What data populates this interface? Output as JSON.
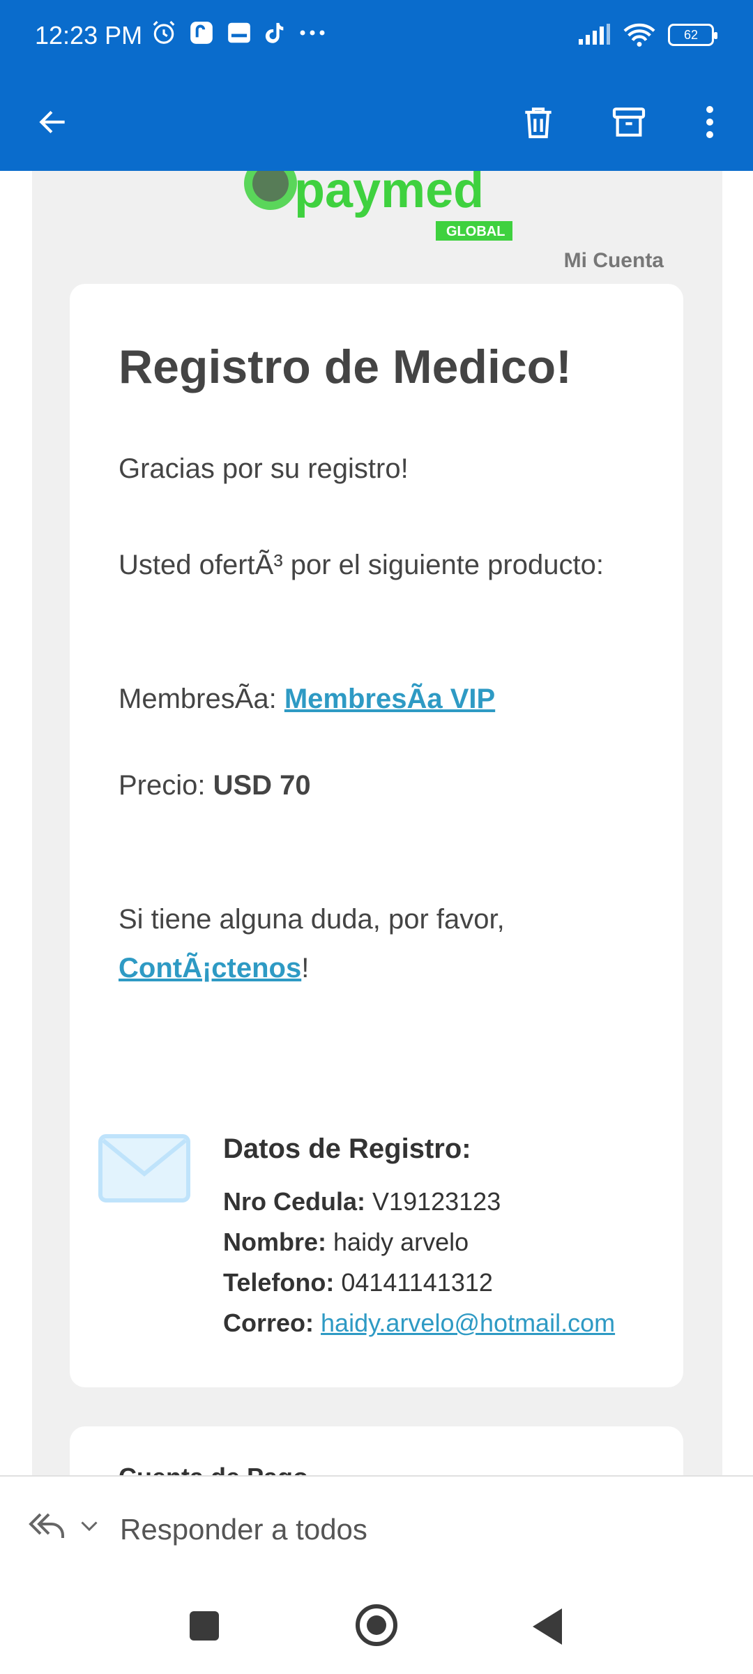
{
  "status_bar": {
    "time": "12:23 PM",
    "battery": "62",
    "icons": [
      "alarm-icon",
      "app-notification-icon",
      "app-notification-icon",
      "tiktok-icon",
      "more-dots-icon",
      "signal-icon",
      "wifi-icon",
      "battery-icon"
    ]
  },
  "app_bar": {
    "icons": [
      "back-arrow-icon",
      "trash-icon",
      "archive-icon",
      "more-vert-icon"
    ]
  },
  "email": {
    "logo_text": "paymed",
    "logo_sub": "GLOBAL",
    "mi_cuenta": "Mi Cuenta",
    "title": "Registro de Medico!",
    "thanks": "Gracias por su registro!",
    "offer": "Usted ofertÃ³ por el siguiente producto:",
    "membership_label": "MembresÃa: ",
    "membership_value": "MembresÃa VIP",
    "price_label": "Precio: ",
    "price_value": "USD 70",
    "doubt_text": "Si tiene alguna duda, por favor,",
    "contact_link": "ContÃ¡ctenos",
    "contact_suffix": "!",
    "registro": {
      "heading": "Datos de Registro:",
      "cedula_label": "Nro Cedula:",
      "cedula_value": "V19123123",
      "nombre_label": "Nombre:",
      "nombre_value": "haidy arvelo",
      "telefono_label": "Telefono:",
      "telefono_value": "04141141312",
      "correo_label": "Correo:",
      "correo_value": "haidy.arvelo@hotmail.com"
    },
    "next_card_partial": "Cuenta de Pago"
  },
  "reply_bar": {
    "label": "Responder a todos"
  },
  "colors": {
    "app_bar": "#0a6ccc",
    "link": "#2e9ac4",
    "logo_green": "#3fd13f",
    "email_bg": "#f0f0f0"
  }
}
